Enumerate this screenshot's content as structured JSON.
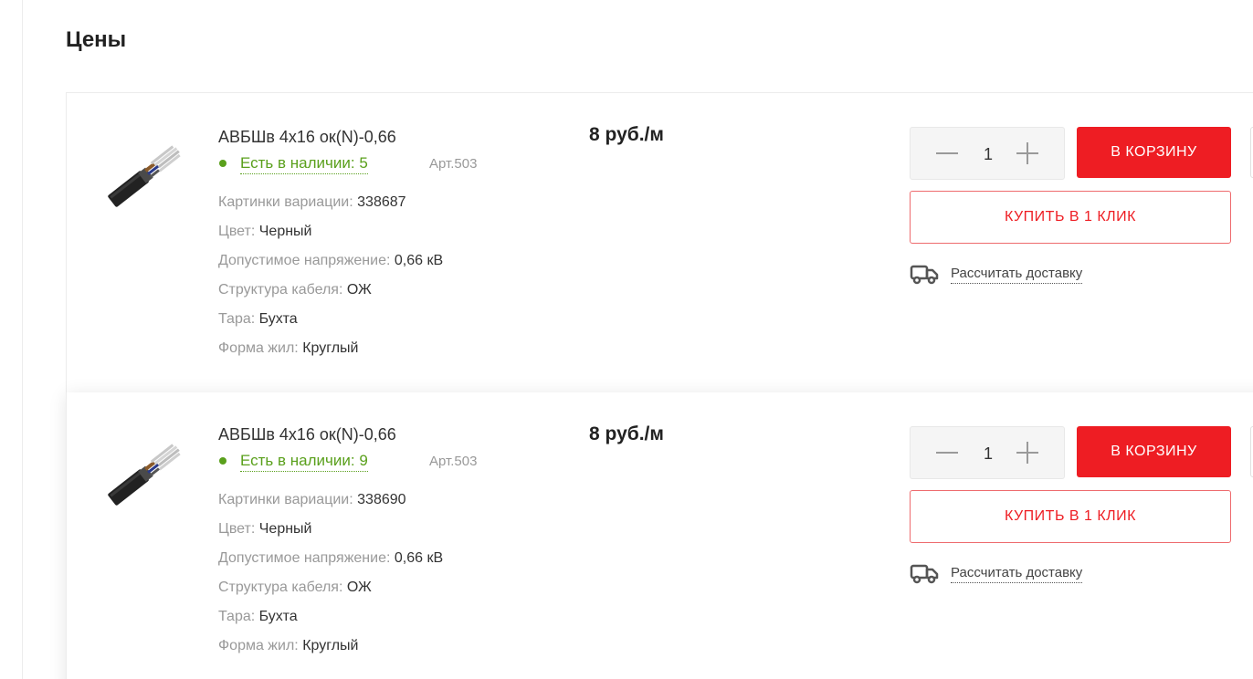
{
  "section": {
    "title": "Цены"
  },
  "colors": {
    "accent_red": "#ee1d23",
    "stock_green": "#5aa01c",
    "muted_text": "#999999"
  },
  "products": [
    {
      "name": "АВБШв 4х16 ок(N)-0,66",
      "stock": "Есть в наличии: 5",
      "sku": "Арт.503",
      "price": "8 руб./м",
      "quantity": "1",
      "cart_label": "В КОРЗИНУ",
      "one_click_label": "КУПИТЬ В 1 КЛИК",
      "delivery_label": "Рассчитать доставку",
      "props": [
        {
          "label": "Картинки вариации:",
          "value": "338687"
        },
        {
          "label": "Цвет:",
          "value": "Черный"
        },
        {
          "label": "Допустимое напряжение:",
          "value": "0,66 кВ"
        },
        {
          "label": "Структура кабеля:",
          "value": "ОЖ"
        },
        {
          "label": "Тара:",
          "value": "Бухта"
        },
        {
          "label": "Форма жил:",
          "value": "Круглый"
        }
      ]
    },
    {
      "name": "АВБШв 4х16 ок(N)-0,66",
      "stock": "Есть в наличии: 9",
      "sku": "Арт.503",
      "price": "8 руб./м",
      "quantity": "1",
      "cart_label": "В КОРЗИНУ",
      "one_click_label": "КУПИТЬ В 1 КЛИК",
      "delivery_label": "Рассчитать доставку",
      "props": [
        {
          "label": "Картинки вариации:",
          "value": "338690"
        },
        {
          "label": "Цвет:",
          "value": "Черный"
        },
        {
          "label": "Допустимое напряжение:",
          "value": "0,66 кВ"
        },
        {
          "label": "Структура кабеля:",
          "value": "ОЖ"
        },
        {
          "label": "Тара:",
          "value": "Бухта"
        },
        {
          "label": "Форма жил:",
          "value": "Круглый"
        }
      ]
    }
  ]
}
